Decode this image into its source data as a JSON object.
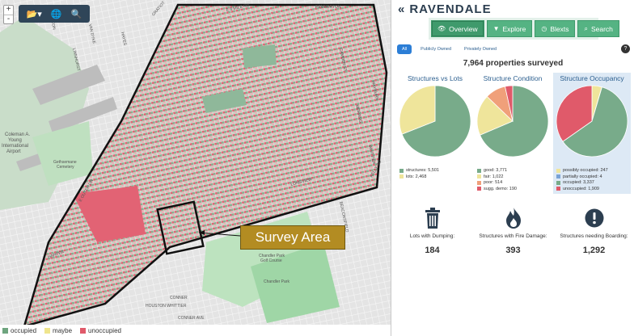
{
  "map": {
    "zoom_in": "+",
    "zoom_out": "-",
    "tools": [
      {
        "name": "folder-icon",
        "glyph": "📂▾"
      },
      {
        "name": "globe-icon",
        "glyph": "🌐"
      },
      {
        "name": "search-icon",
        "glyph": "🔍"
      }
    ],
    "survey_label": "Survey Area",
    "legend": [
      {
        "label": "occupied",
        "color": "#6fa57f"
      },
      {
        "label": "maybe",
        "color": "#efe58d"
      },
      {
        "label": "unoccupied",
        "color": "#e05a6a"
      }
    ],
    "place_labels": [
      "Coleman A.",
      "Young",
      "International",
      "Airport",
      "Gethsemane",
      "Cemetery",
      "Chandler Park",
      "Golf Course",
      "Chandler Park",
      "CONNER",
      "E 8 MILE RD",
      "HAYES",
      "GRATIOT",
      "VAN DYKE",
      "PEMBERTON",
      "CAMDEN ST",
      "MORANG",
      "WHITTIER",
      "KELLY RD",
      "E OUTER DR",
      "WAYBURN",
      "HARPER",
      "HOUSTON WHITTIER",
      "CONNER AVE",
      "STOCKTON",
      "LINNHURST",
      "LONGVIEW",
      "BEACONSFIELD"
    ]
  },
  "panel": {
    "title": "RAVENDALE",
    "nav": [
      {
        "label": "Overview",
        "icon": "eye-icon",
        "glyph": "👁",
        "active": true
      },
      {
        "label": "Explore",
        "icon": "filter-icon",
        "glyph": "▼",
        "active": false
      },
      {
        "label": "Blexts",
        "icon": "clock-icon",
        "glyph": "◷",
        "active": false
      },
      {
        "label": "Search",
        "icon": "search-icon",
        "glyph": "⌕",
        "active": false
      }
    ],
    "subtabs": [
      {
        "label": "All",
        "active": true
      },
      {
        "label": "Publicly Owned",
        "active": false
      },
      {
        "label": "Privately Owned",
        "active": false
      }
    ],
    "summary": "7,964 properties surveyed",
    "charts": [
      {
        "title": "Structures vs Lots",
        "highlight": false,
        "legend": [
          {
            "label": "structures: 5,501",
            "value": 5501,
            "color": "#78ab8a"
          },
          {
            "label": "lots: 2,468",
            "value": 2468,
            "color": "#efe59b"
          }
        ]
      },
      {
        "title": "Structure Condition",
        "highlight": false,
        "legend": [
          {
            "label": "good: 3,771",
            "value": 3771,
            "color": "#78ab8a"
          },
          {
            "label": "fair: 1,022",
            "value": 1022,
            "color": "#efe59b"
          },
          {
            "label": "poor: 514",
            "value": 514,
            "color": "#f0a07a"
          },
          {
            "label": "sugg. demo: 190",
            "value": 190,
            "color": "#e05a6a"
          }
        ]
      },
      {
        "title": "Structure Occupancy",
        "highlight": true,
        "legend": [
          {
            "label": "possibly occupied: 247",
            "value": 247,
            "color": "#efe59b"
          },
          {
            "label": "partially occupied: 4",
            "value": 4,
            "color": "#7aa3d6"
          },
          {
            "label": "occupied: 3,337",
            "value": 3337,
            "color": "#78ab8a"
          },
          {
            "label": "unoccupied: 1,909",
            "value": 1909,
            "color": "#e05a6a"
          }
        ]
      }
    ],
    "stats": [
      {
        "label": "Lots with Dumping:",
        "value": "184",
        "icon": "trash-icon"
      },
      {
        "label": "Structures with Fire Damage:",
        "value": "393",
        "icon": "fire-icon"
      },
      {
        "label": "Structures needing Boarding:",
        "value": "1,292",
        "icon": "exclamation-icon"
      }
    ]
  }
}
